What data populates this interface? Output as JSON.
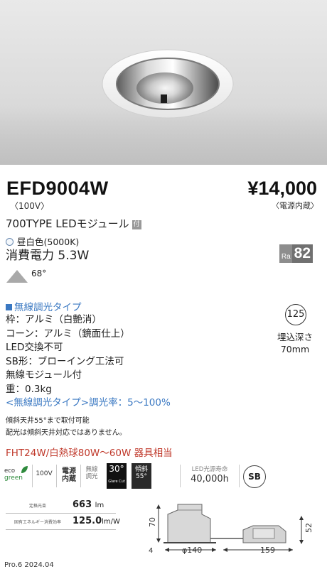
{
  "product": {
    "model": "EFD9004W",
    "voltage": "〈100V〉",
    "price": "¥14,000",
    "price_note": "〈電源内蔵〉",
    "module": "700TYPE LEDモジュール",
    "module_badge": "付",
    "light_color": "昼白色(5000K)",
    "power": "消費電力 5.3W",
    "ra_label": "Ra",
    "ra_value": "82",
    "beam_angle": "68°"
  },
  "spec": {
    "wireless_title": "無線調光タイプ",
    "lines": [
      "枠：アルミ（白艶消）",
      "コーン：アルミ（鏡面仕上）",
      "LED交換不可",
      "SB形：ブローイング工法可",
      "無線モジュール付",
      "重：0.3kg"
    ],
    "dimming": "<無線調光タイプ>調光率：5～100%"
  },
  "install": {
    "badge": "125",
    "embed_label": "埋込深さ",
    "embed_value": "70mm"
  },
  "notes": [
    "傾斜天井55°まで取付可能",
    "配光は傾斜天井対応ではありません。"
  ],
  "equivalent": "FHT24W/白熱球80W～60W 器具相当",
  "icons": {
    "eco_top": "eco",
    "eco_bottom": "green",
    "voltage": "100V",
    "power_builtin_1": "電源",
    "power_builtin_2": "内蔵",
    "wireless_1": "無線",
    "wireless_2": "調光",
    "glare_angle": "30°",
    "glare_label": "Glare Cut",
    "slope_1": "傾斜",
    "slope_2": "55°",
    "life_label": "LED光源寿命",
    "life_value": "40,000h",
    "sb": "SB"
  },
  "table": [
    {
      "label": "定格光束",
      "value": "663",
      "unit": "lm"
    },
    {
      "label": "固有エネルギー消費効率",
      "value": "125.0",
      "unit": "lm/W"
    }
  ],
  "drawing": {
    "height": "70",
    "base": "4",
    "diameter": "φ140",
    "width": "159",
    "box_height": "52"
  },
  "footer": "Pro.6 2024.04",
  "colors": {
    "accent_blue": "#3a78c2",
    "red": "#c0392b"
  }
}
